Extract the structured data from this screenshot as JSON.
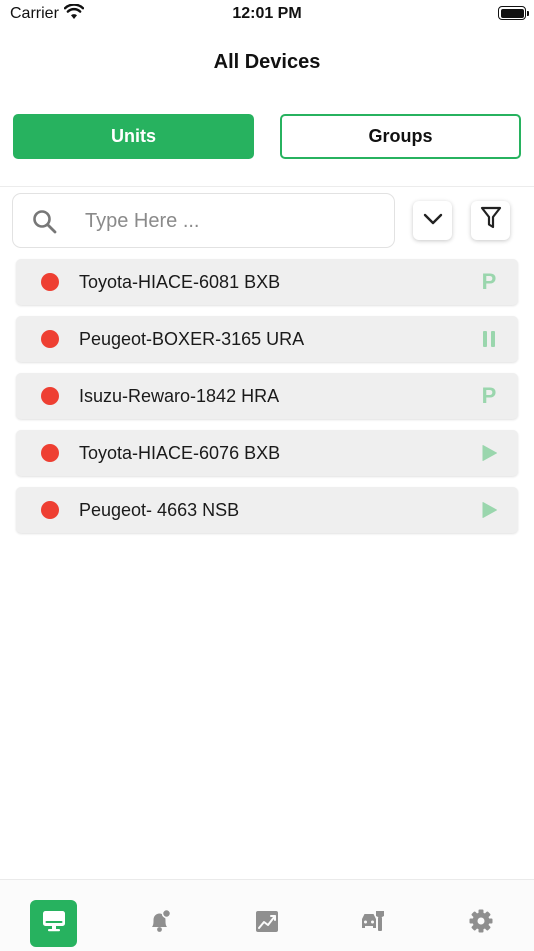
{
  "status_bar": {
    "carrier": "Carrier",
    "time": "12:01 PM"
  },
  "header": {
    "title": "All Devices"
  },
  "segments": {
    "units": "Units",
    "groups": "Groups",
    "selected": "units"
  },
  "search": {
    "placeholder": "Type Here ..."
  },
  "units": [
    {
      "name": "Toyota-HIACE-6081 BXB",
      "state": "parked",
      "state_glyph": "P"
    },
    {
      "name": "Peugeot-BOXER-3165 URA",
      "state": "paused",
      "state_glyph": ""
    },
    {
      "name": "Isuzu-Rewaro-1842 HRA",
      "state": "parked",
      "state_glyph": "P"
    },
    {
      "name": "Toyota-HIACE-6076 BXB",
      "state": "moving",
      "state_glyph": ""
    },
    {
      "name": "Peugeot- 4663 NSB",
      "state": "moving",
      "state_glyph": ""
    }
  ],
  "tabbar": {
    "items": [
      "devices-icon",
      "alerts-icon",
      "reports-icon",
      "maintenance-icon",
      "settings-icon"
    ],
    "active": "devices-icon"
  },
  "colors": {
    "accent": "#27b25f",
    "status_offline": "#ee3f32",
    "state_icon": "#9ad6ad",
    "tab_icon_inactive": "#8f8f8f"
  }
}
